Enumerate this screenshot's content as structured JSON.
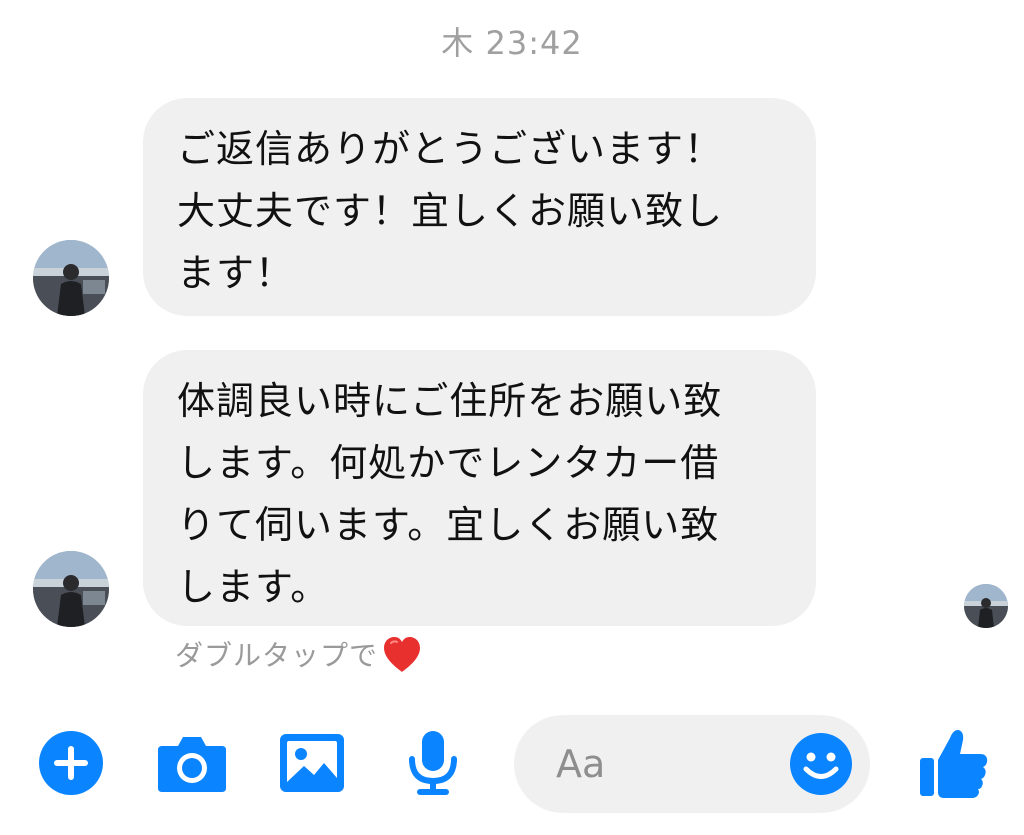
{
  "header": {
    "timestamp": "木 23:42"
  },
  "messages": [
    {
      "text": "ご返信ありがとうございます！\n大丈夫です！宜しくお願い致し\nます！"
    },
    {
      "text": "体調良い時にご住所をお願い致\nします。何処かでレンタカー借\nりて伺います。宜しくお願い致\nします。"
    }
  ],
  "hint": {
    "text": "ダブルタップで"
  },
  "composer": {
    "placeholder": "Aa"
  },
  "colors": {
    "accent": "#0a84ff",
    "bubble": "#f0f0f0",
    "heart": "#e8312f"
  },
  "icons": [
    "plus-icon",
    "camera-icon",
    "photo-icon",
    "microphone-icon",
    "smiley-icon",
    "thumbs-up-icon",
    "heart-icon"
  ]
}
